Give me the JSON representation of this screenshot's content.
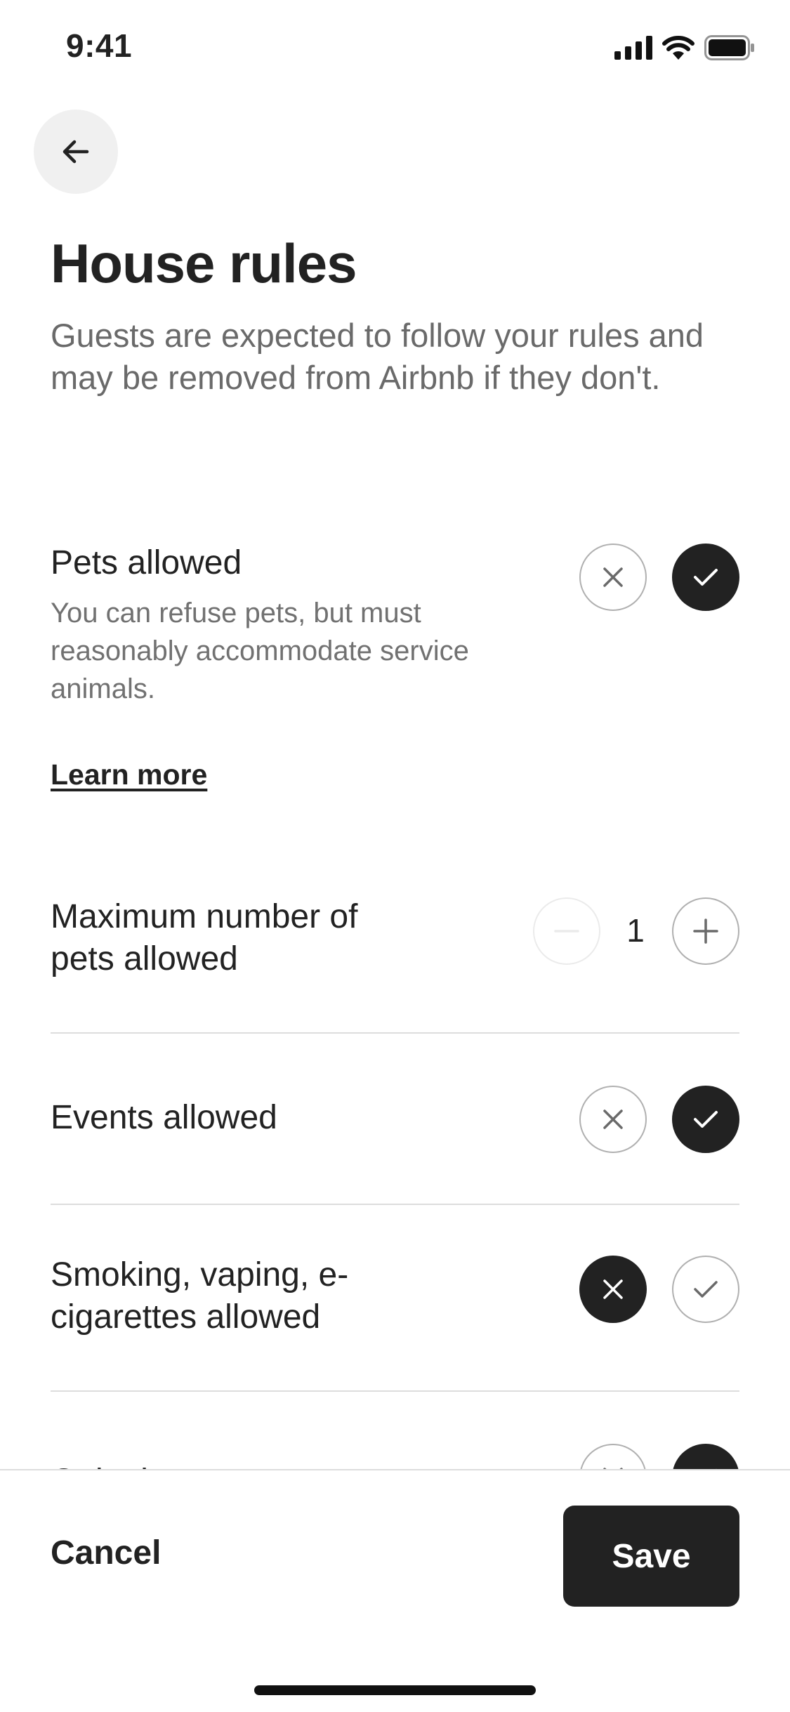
{
  "status_bar": {
    "time": "9:41"
  },
  "header": {
    "back_icon": "arrow-left-icon",
    "title": "House rules",
    "subtitle": "Guests are expected to follow your rules and may be removed from Airbnb if they don't."
  },
  "rules": {
    "pets": {
      "label": "Pets allowed",
      "description": "You can refuse pets, but must reasonably accommodate service animals.",
      "learn_more": "Learn more",
      "selected": "yes"
    },
    "max_pets": {
      "label": "Maximum number of pets allowed",
      "value": "1",
      "decrement_enabled": false
    },
    "events": {
      "label": "Events allowed",
      "selected": "yes"
    },
    "smoking": {
      "label": "Smoking, vaping, e-cigarettes allowed",
      "selected": "no"
    },
    "quiet_hours": {
      "label": "Quiet hours",
      "selected": "yes"
    }
  },
  "footer": {
    "cancel_label": "Cancel",
    "save_label": "Save"
  },
  "colors": {
    "accent": "#222222",
    "muted_text": "#717171",
    "divider": "#dddddd",
    "back_button_bg": "#f0f0f0"
  }
}
